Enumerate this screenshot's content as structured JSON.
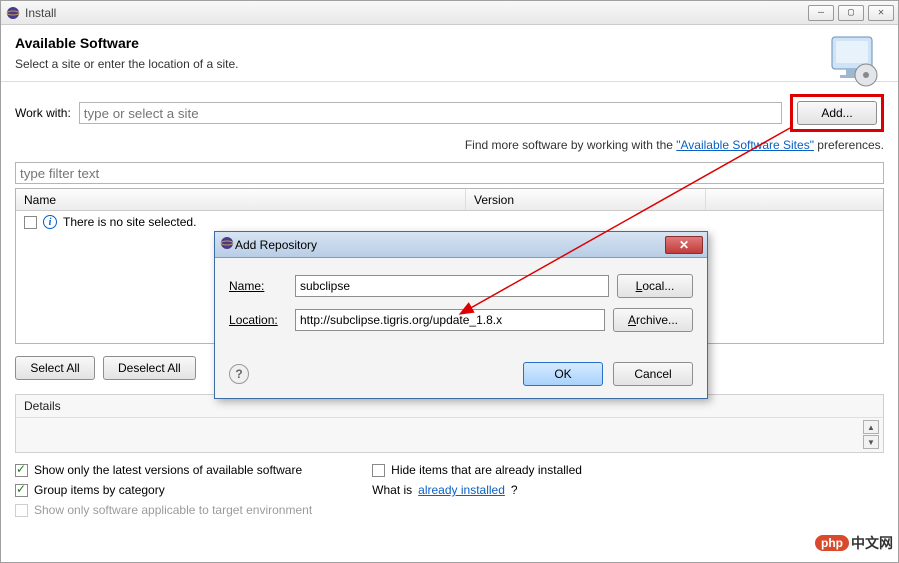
{
  "window": {
    "title": "Install",
    "heading": "Available Software",
    "subtitle": "Select a site or enter the location of a site."
  },
  "workWith": {
    "label": "Work with:",
    "placeholder": "type or select a site",
    "addButton": "Add...",
    "findMorePrefix": "Find more software by working with the ",
    "findMoreLink": "\"Available Software Sites\"",
    "findMoreSuffix": " preferences."
  },
  "filter": {
    "placeholder": "type filter text"
  },
  "table": {
    "columns": {
      "name": "Name",
      "version": "Version"
    },
    "emptyMessage": "There is no site selected."
  },
  "buttons": {
    "selectAll": "Select All",
    "deselectAll": "Deselect All"
  },
  "details": {
    "label": "Details"
  },
  "options": {
    "showLatest": "Show only the latest versions of available software",
    "groupByCategory": "Group items by category",
    "showApplicable": "Show only software applicable to target environment",
    "hideInstalled": "Hide items that are already installed",
    "whatIsPrefix": "What is ",
    "whatIsLink": "already installed",
    "whatIsSuffix": "?"
  },
  "dialog": {
    "title": "Add Repository",
    "nameLabel": "Name:",
    "nameValue": "subclipse",
    "locationLabel": "Location:",
    "locationValue": "http://subclipse.tigris.org/update_1.8.x",
    "localButton": "Local...",
    "archiveButton": "Archive...",
    "okButton": "OK",
    "cancelButton": "Cancel"
  },
  "watermark": {
    "badge": "php",
    "text": "中文网"
  }
}
